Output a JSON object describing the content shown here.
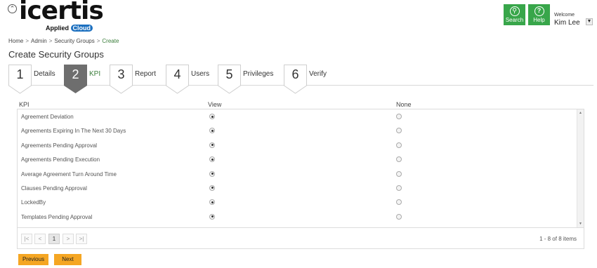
{
  "header": {
    "logo_text": "icertis",
    "logo_sub_text": "Applied",
    "logo_cloud_text": "Cloud",
    "search_label": "Search",
    "help_label": "Help",
    "welcome_label": "Welcome",
    "user_name": "Kim Lee",
    "accent_color": "#38a64a"
  },
  "breadcrumb": {
    "items": [
      "Home",
      "Admin",
      "Security Groups",
      "Create"
    ],
    "separator": ">"
  },
  "page_title": "Create Security Groups",
  "wizard": {
    "active_step": 2,
    "steps": [
      {
        "number": "1",
        "label": "Details"
      },
      {
        "number": "2",
        "label": "KPI"
      },
      {
        "number": "3",
        "label": "Report"
      },
      {
        "number": "4",
        "label": "Users"
      },
      {
        "number": "5",
        "label": "Privileges"
      },
      {
        "number": "6",
        "label": "Verify"
      }
    ]
  },
  "grid": {
    "columns": {
      "kpi": "KPI",
      "view": "View",
      "none": "None"
    },
    "rows": [
      {
        "kpi": "Agreement Deviation",
        "selected": "view"
      },
      {
        "kpi": "Agreements Expiring In The Next 30 Days",
        "selected": "view"
      },
      {
        "kpi": "Agreements Pending Approval",
        "selected": "view"
      },
      {
        "kpi": "Agreements Pending Execution",
        "selected": "view"
      },
      {
        "kpi": "Average Agreement Turn Around Time",
        "selected": "view"
      },
      {
        "kpi": "Clauses Pending Approval",
        "selected": "view"
      },
      {
        "kpi": "LockedBy",
        "selected": "view"
      },
      {
        "kpi": "Templates Pending Approval",
        "selected": "view"
      }
    ]
  },
  "pager": {
    "first": "|<",
    "prev": "<",
    "current_page": "1",
    "next": ">",
    "last": ">|",
    "info": "1 - 8 of 8 items"
  },
  "actions": {
    "previous_label": "Previous",
    "next_label": "Next",
    "button_color": "#f5a623"
  }
}
